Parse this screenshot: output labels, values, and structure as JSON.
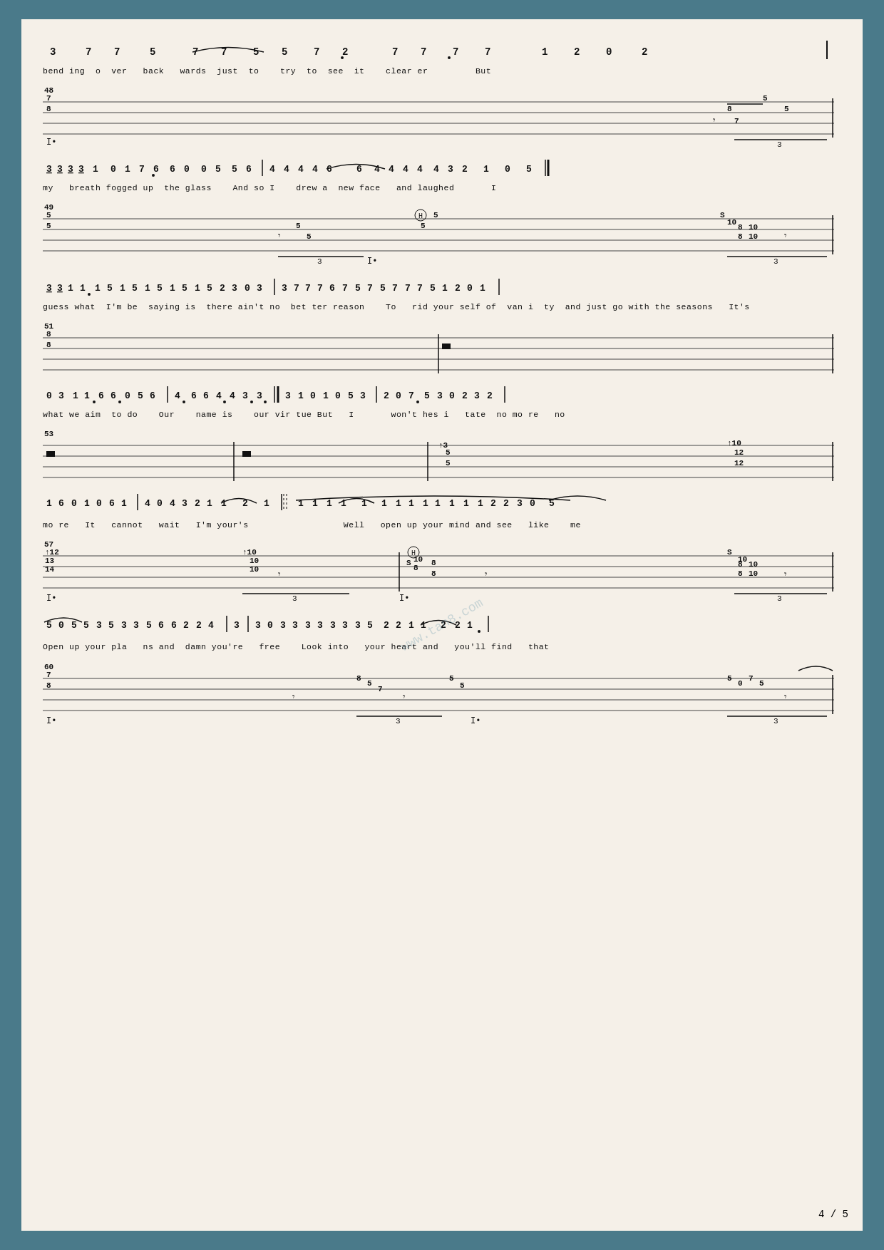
{
  "page": {
    "background": "#4a7a8a",
    "paper_bg": "#f5f0e8",
    "page_number": "4 / 5",
    "watermark": "www.tan8.com"
  },
  "sections": [
    {
      "id": "s1",
      "tab_numbers": "3  7  7  5    7  7  5  5  7  2    7  7  7  7    1  2  0  2",
      "lyrics": "bend ing  o  ver   back   wards  just  to    try  to  see  it    clear er         But"
    },
    {
      "id": "s2",
      "measure": "48",
      "tab_numbers": "3 3 3 3 1   0 1 7 6   6 0   0 5   5 6  |  4  4 4 4 6   6 4 4 4   4 3 2   1   0  5 ||",
      "lyrics": "my   breath fogged up  the glass    And so I    drew a  new face   and laughed       I"
    },
    {
      "id": "s3",
      "measure": "49",
      "tab_numbers": "3 3 1 1   1 5   1 5 1 5   1  5 1 5  2 3 0 3  |  3 7 7 7 6   7 5 7 5   7 7 7 5   1 2 0 1  |",
      "lyrics": "guess what  I'm be  saying is  there ain't no  bet ter reason    To   rid your self of  van i  ty  and just go with the seasons   It's"
    },
    {
      "id": "s4",
      "measure": "51",
      "tab_numbers": ""
    },
    {
      "id": "s5",
      "tab_numbers": "0 3   1 1·  6 6·  0 5 6  |  4·  6 6 4·  4  3· 3·  ||   3 1 0 1 0 5 3  |   2 0 7·  5 3 0 2 3 2  |",
      "lyrics": "what we aim  to do    Our    name is    our vir tue But   I       won't hes i   tate  no mo re   no"
    },
    {
      "id": "s6",
      "measure": "53"
    },
    {
      "id": "s7",
      "tab_numbers": "1 6 0 1 0 6 1   |  4 0 4 3 2 1  1  2   1    |  1  1 1 1  1 1 1  1   1  1 2 2 3 0   5",
      "lyrics": "mo re   It   cannot   wait   I'm your's                  Well   open up your mind and see   like    me"
    },
    {
      "id": "s8",
      "measure": "57"
    },
    {
      "id": "s9",
      "tab_numbers": "5 0 5 5 3 5 3 3   5 6 6 2 2 4      3  |  3 0 3 3 3 3 3 3 3 5   2 2 1  1 2 2 1·   |",
      "lyrics": "Open up your pla   ns and  damn you're   free    Look into   your heart and   you'll find   that"
    },
    {
      "id": "s10",
      "measure": "60"
    }
  ]
}
